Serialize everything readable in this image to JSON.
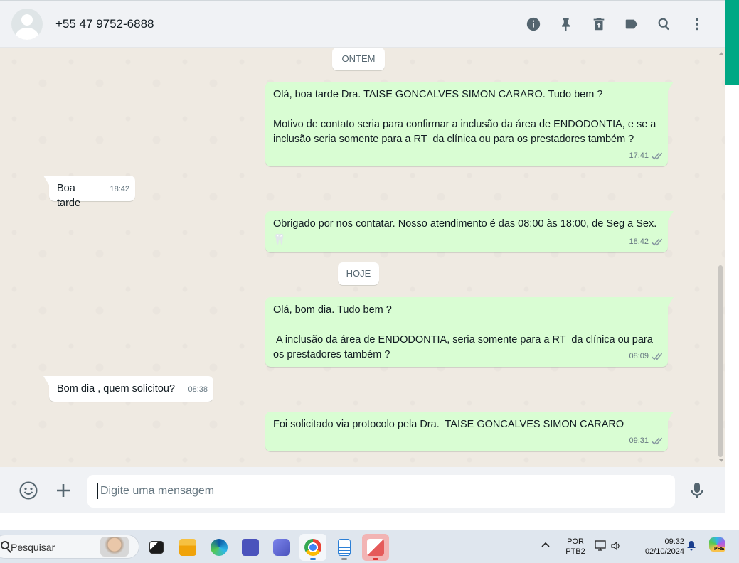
{
  "header": {
    "contact_name": "+55 47 9752-6888",
    "icons": [
      "info-icon",
      "pin-icon",
      "delete-icon",
      "label-icon",
      "search-icon",
      "menu-icon"
    ]
  },
  "chat": {
    "date_yesterday": "ONTEM",
    "date_today": "HOJE",
    "messages": [
      {
        "dir": "out",
        "text": "Olá, boa tarde Dra. TAISE GONCALVES SIMON CARARO. Tudo bem ?\n\nMotivo de contato seria para confirmar a inclusão da área de ENDODONTIA, e se a inclusão seria somente para a RT  da clínica ou para os prestadores também ?",
        "time": "17:41"
      },
      {
        "dir": "in",
        "text": "Boa tarde",
        "time": "18:42"
      },
      {
        "dir": "out",
        "text": "Obrigado por nos contatar. Nosso atendimento é das 08:00 às 18:00, de Seg a Sex.",
        "time": "18:42",
        "emoji": "🦷"
      },
      {
        "dir": "out",
        "text": "Olá, bom dia. Tudo bem ?\n\n A inclusão da área de ENDODONTIA, seria somente para a RT  da clínica ou para os prestadores também ?",
        "time": "08:09"
      },
      {
        "dir": "in",
        "text": "Bom dia , quem solicitou?",
        "time": "08:38"
      },
      {
        "dir": "out",
        "text": "Foi solicitado via protocolo pela Dra.  TAISE GONCALVES SIMON CARARO",
        "time": "09:31"
      }
    ]
  },
  "composer": {
    "placeholder": "Digite uma mensagem"
  },
  "taskbar": {
    "search_label": "Pesquisar",
    "language_line1": "POR",
    "language_line2": "PTB2",
    "clock_time": "09:32",
    "clock_date": "02/10/2024",
    "copilot_badge": "PRE"
  },
  "colors": {
    "accent": "#00a884",
    "outgoing_bubble": "#d9fdd3",
    "incoming_bubble": "#ffffff",
    "chat_bg": "#efeae2"
  }
}
